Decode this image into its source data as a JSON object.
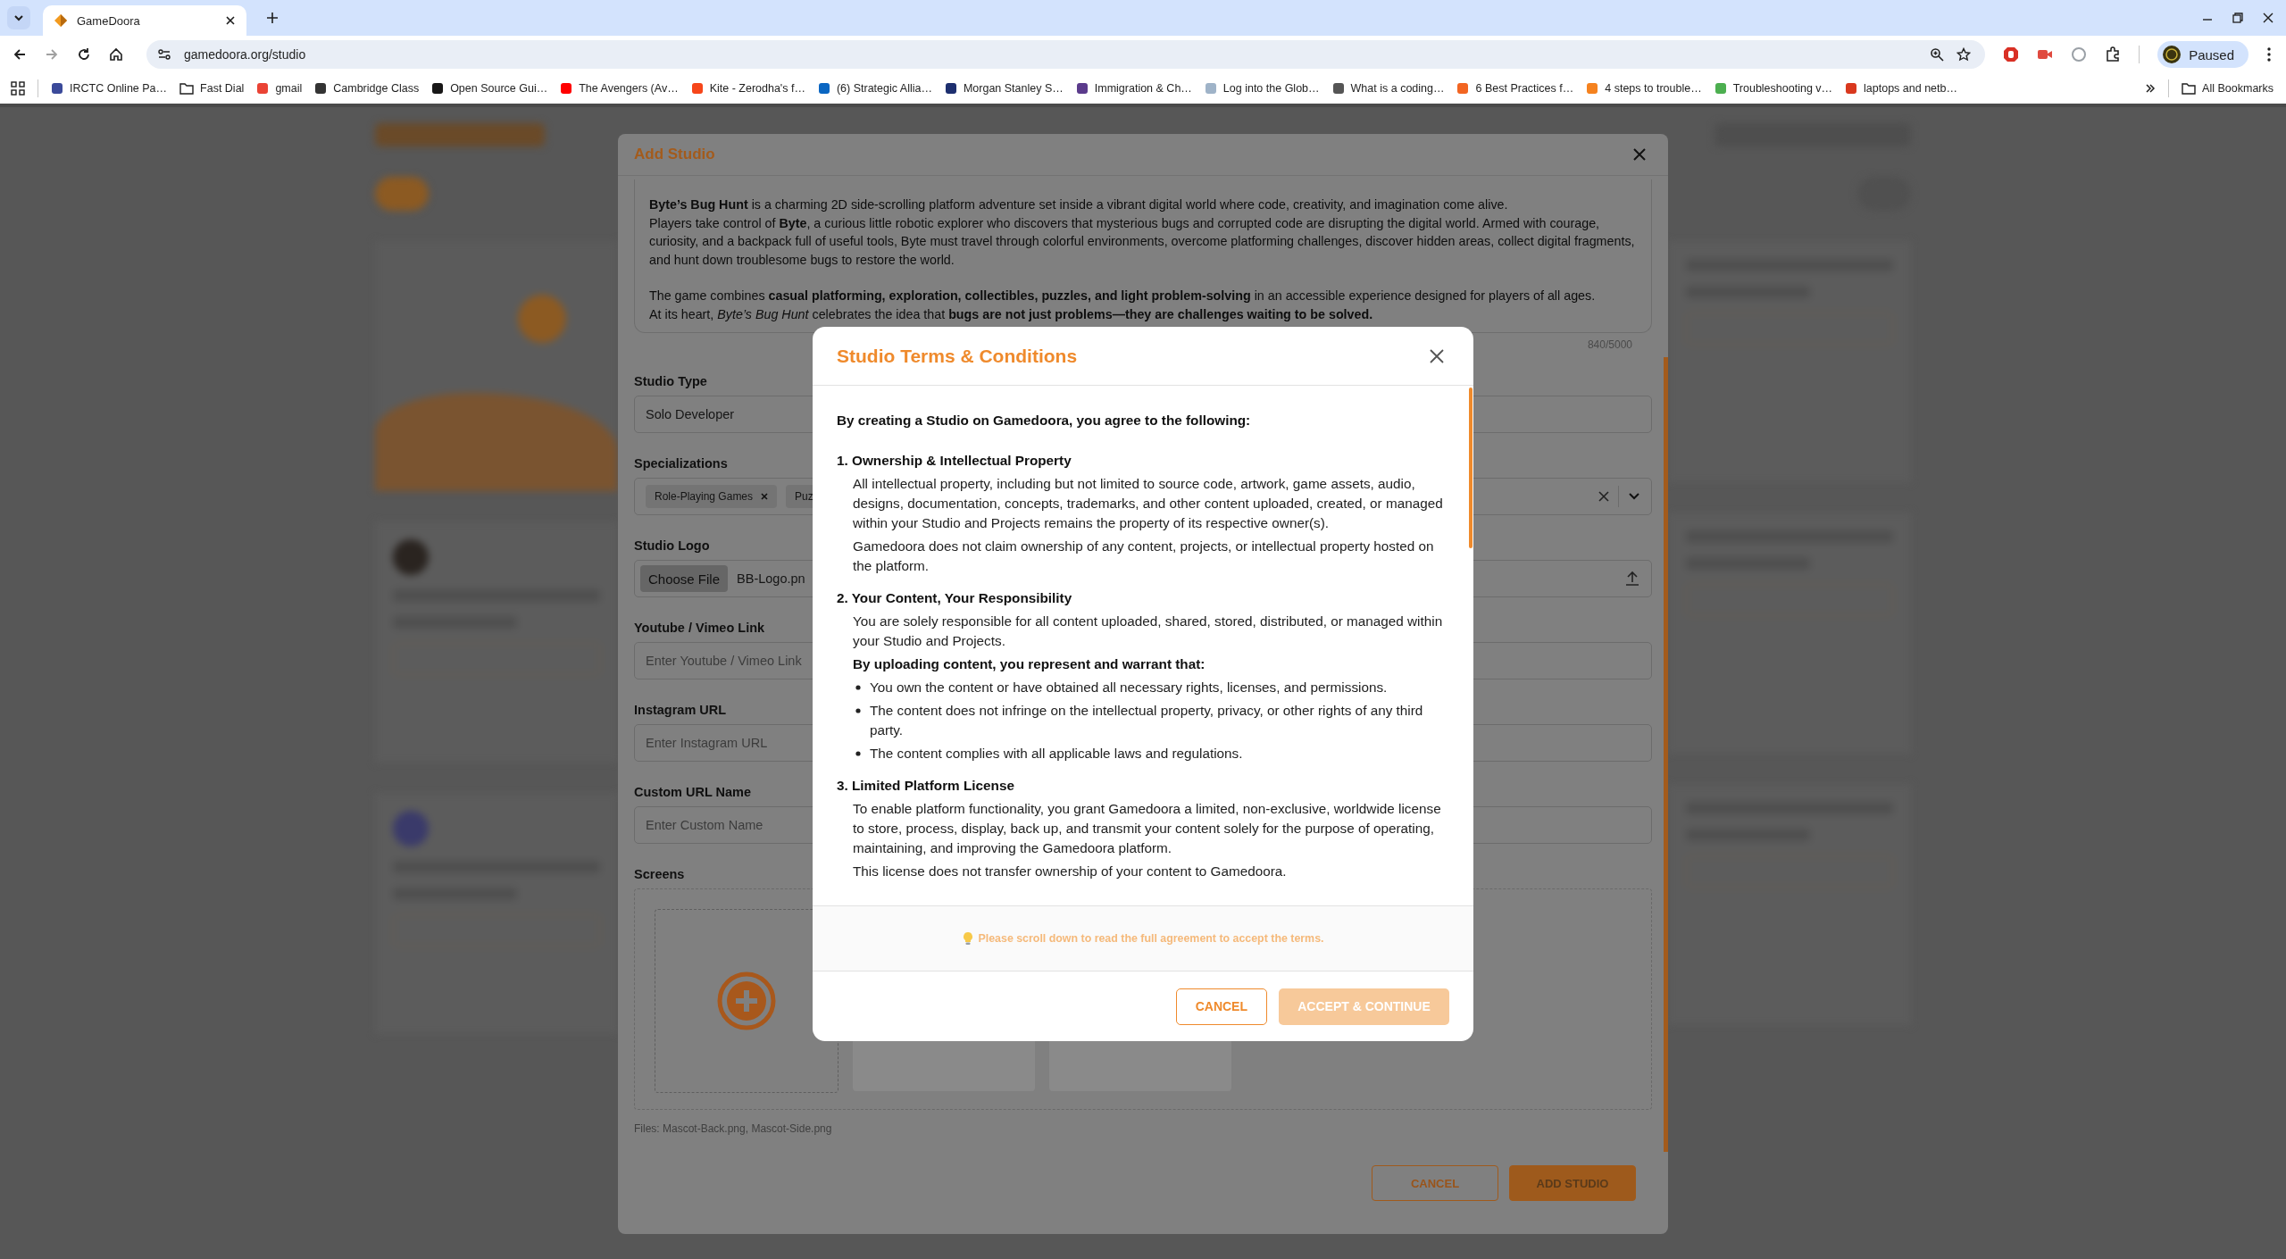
{
  "browser": {
    "tabs": [
      {
        "title": "GameDoora",
        "selected": true
      }
    ],
    "url": "gamedoora.org/studio",
    "profile": "Paused",
    "bookmarks": [
      {
        "label": "IRCTC Online Pa…",
        "kind": "site",
        "color": "#3b4a9a"
      },
      {
        "label": "Fast Dial",
        "kind": "folder"
      },
      {
        "label": "gmail",
        "kind": "site",
        "color": "#ea4335"
      },
      {
        "label": "Cambridge Class",
        "kind": "site",
        "color": "#333333"
      },
      {
        "label": "Open Source Gui…",
        "kind": "site",
        "color": "#181717"
      },
      {
        "label": "The Avengers (Av…",
        "kind": "site",
        "color": "#ff0000"
      },
      {
        "label": "Kite - Zerodha's f…",
        "kind": "site",
        "color": "#f6461a"
      },
      {
        "label": "(6) Strategic Allia…",
        "kind": "site",
        "color": "#0a66c2"
      },
      {
        "label": "Morgan Stanley S…",
        "kind": "site",
        "color": "#1d2f6f"
      },
      {
        "label": "Immigration & Ch…",
        "kind": "site",
        "color": "#5b3b8c"
      },
      {
        "label": "Log into the Glob…",
        "kind": "site",
        "color": "#9fb3c8"
      },
      {
        "label": "What is a coding…",
        "kind": "site",
        "color": "#555555"
      },
      {
        "label": "6 Best Practices f…",
        "kind": "site",
        "color": "#f26522"
      },
      {
        "label": "4 steps to trouble…",
        "kind": "site",
        "color": "#f5821f"
      },
      {
        "label": "Troubleshooting v…",
        "kind": "site",
        "color": "#4caf50"
      },
      {
        "label": "laptops and netb…",
        "kind": "site",
        "color": "#d9381e"
      }
    ],
    "all_bookmarks": "All Bookmarks"
  },
  "add_studio": {
    "title": "Add Studio",
    "description": [
      "**Byte’s Bug Hunt** is a charming 2D side-scrolling platform adventure set inside a vibrant digital world where code, creativity, and imagination come alive.",
      "Players take control of **Byte**, a curious little robotic explorer who discovers that mysterious bugs and corrupted code are disrupting the digital world. Armed with courage, curiosity, and a backpack full of useful tools, Byte must travel through colorful environments, overcome platforming challenges, discover hidden areas, collect digital fragments, and hunt down troublesome bugs to restore the world.",
      "The game combines **casual platforming, exploration, collectibles, puzzles, and light problem-solving** in an accessible experience designed for players of all ages.",
      "At its heart, *Byte’s Bug Hunt* celebrates the idea that **bugs are not just problems—they are challenges waiting to be solved.**"
    ],
    "char_count": "840/5000",
    "fields": [
      {
        "label": "Studio Type",
        "kind": "select",
        "value": "Solo Developer"
      },
      {
        "label": "Specializations",
        "kind": "chips",
        "chips": [
          {
            "label": "Role-Playing Games",
            "removable": true
          },
          {
            "label": "Puz",
            "removable": false
          }
        ]
      },
      {
        "label": "Studio Logo",
        "kind": "file",
        "button": "Choose File",
        "value": "BB-Logo.pn"
      },
      {
        "label": "Youtube / Vimeo Link",
        "kind": "text",
        "placeholder": "Enter Youtube / Vimeo Link"
      },
      {
        "label": "Instagram URL",
        "kind": "text",
        "placeholder": "Enter Instagram URL"
      },
      {
        "label": "Custom URL Name",
        "kind": "text",
        "placeholder": "Enter Custom Name"
      }
    ],
    "screens": {
      "label": "Screens",
      "thumbnails": [
        {
          "kind": "image"
        },
        {
          "kind": "image"
        }
      ]
    },
    "files_note": "Files: Mascot-Back.png, Mascot-Side.png",
    "buttons": [
      {
        "label": "CANCEL",
        "kind": "outline"
      },
      {
        "label": "ADD STUDIO",
        "kind": "primary"
      }
    ]
  },
  "terms": {
    "title": "Studio Terms & Conditions",
    "intro": "By creating a Studio on Gamedoora, you agree to the following:",
    "sections": [
      {
        "title": "1. Ownership & Intellectual Property",
        "blocks": [
          {
            "kind": "p",
            "text": "All intellectual property, including but not limited to source code, artwork, game assets, audio, designs, documentation, concepts, trademarks, and other content uploaded, created, or managed within your Studio and Projects remains the property of its respective owner(s)."
          },
          {
            "kind": "p",
            "text": "Gamedoora does not claim ownership of any content, projects, or intellectual property hosted on the platform."
          }
        ]
      },
      {
        "title": "2. Your Content, Your Responsibility",
        "blocks": [
          {
            "kind": "p",
            "text": "You are solely responsible for all content uploaded, shared, stored, distributed, or managed within your Studio and Projects."
          },
          {
            "kind": "sub",
            "text": "By uploading content, you represent and warrant that:"
          },
          {
            "kind": "bullets",
            "items": [
              "You own the content or have obtained all necessary rights, licenses, and permissions.",
              "The content does not infringe on the intellectual property, privacy, or other rights of any third party.",
              "The content complies with all applicable laws and regulations."
            ]
          }
        ]
      },
      {
        "title": "3. Limited Platform License",
        "blocks": [
          {
            "kind": "p",
            "text": "To enable platform functionality, you grant Gamedoora a limited, non-exclusive, worldwide license to store, process, display, back up, and transmit your content solely for the purpose of operating, maintaining, and improving the Gamedoora platform."
          },
          {
            "kind": "p",
            "text": "This license does not transfer ownership of your content to Gamedoora."
          }
        ]
      }
    ],
    "notice": "Please scroll down to read the full agreement to accept the terms.",
    "buttons": [
      {
        "label": "CANCEL",
        "kind": "outline",
        "disabled": false
      },
      {
        "label": "ACCEPT & CONTINUE",
        "kind": "primary",
        "disabled": true
      }
    ]
  }
}
